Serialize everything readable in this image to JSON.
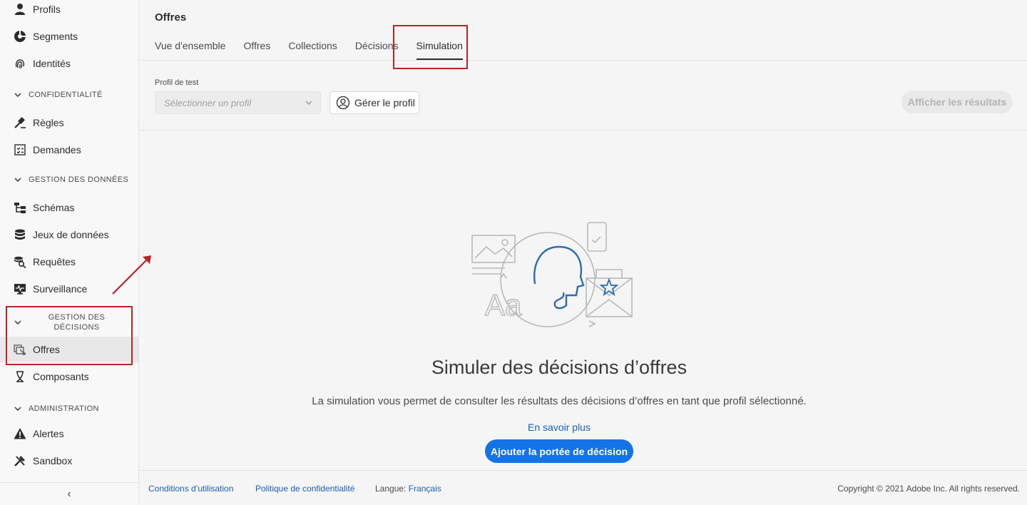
{
  "sidebar": {
    "items_top": [
      {
        "label": "Profils",
        "icon": "user-icon"
      },
      {
        "label": "Segments",
        "icon": "segments-icon"
      },
      {
        "label": "Identités",
        "icon": "fingerprint-icon"
      }
    ],
    "section_privacy": "CONFIDENTIALITÉ",
    "items_privacy": [
      {
        "label": "Règles",
        "icon": "gavel-icon"
      },
      {
        "label": "Demandes",
        "icon": "checklist-icon"
      }
    ],
    "section_data": "GESTION DES DONNÉES",
    "items_data": [
      {
        "label": "Schémas",
        "icon": "schema-icon"
      },
      {
        "label": "Jeux de données",
        "icon": "database-icon"
      },
      {
        "label": "Requêtes",
        "icon": "query-icon"
      },
      {
        "label": "Surveillance",
        "icon": "monitor-icon"
      }
    ],
    "section_decisions_line1": "GESTION DES",
    "section_decisions_line2": "DÉCISIONS",
    "items_decisions": [
      {
        "label": "Offres",
        "icon": "offers-icon"
      },
      {
        "label": "Composants",
        "icon": "components-icon"
      }
    ],
    "section_admin": "ADMINISTRATION",
    "items_admin": [
      {
        "label": "Alertes",
        "icon": "alert-icon"
      },
      {
        "label": "Sandbox",
        "icon": "sandbox-icon"
      }
    ],
    "collapse_glyph": "‹"
  },
  "header": {
    "title": "Offres",
    "tabs": [
      {
        "label": "Vue d'ensemble"
      },
      {
        "label": "Offres"
      },
      {
        "label": "Collections"
      },
      {
        "label": "Décisions"
      },
      {
        "label": "Simulation",
        "active": true
      }
    ]
  },
  "toolbar": {
    "field_label": "Profil de test",
    "select_placeholder": "Sélectionner un profil",
    "manage_profile": "Gérer le profil",
    "show_results": "Afficher les résultats"
  },
  "empty_state": {
    "title": "Simuler des décisions d’offres",
    "description": "La simulation vous permet de consulter les résultats des décisions d’offres en tant que profil sélectionné.",
    "learn_more": "En savoir plus",
    "cta": "Ajouter la portée de décision",
    "illustration_text": "Aa"
  },
  "footer": {
    "terms": "Conditions d’utilisation",
    "privacy": "Politique de confidentialité",
    "language_label": "Langue:",
    "language_value": "Français",
    "copyright": "Copyright © 2021 Adobe Inc. All rights reserved."
  },
  "colors": {
    "accent": "#1473e6",
    "annotation": "#b82525",
    "link": "#1a5fbe"
  }
}
